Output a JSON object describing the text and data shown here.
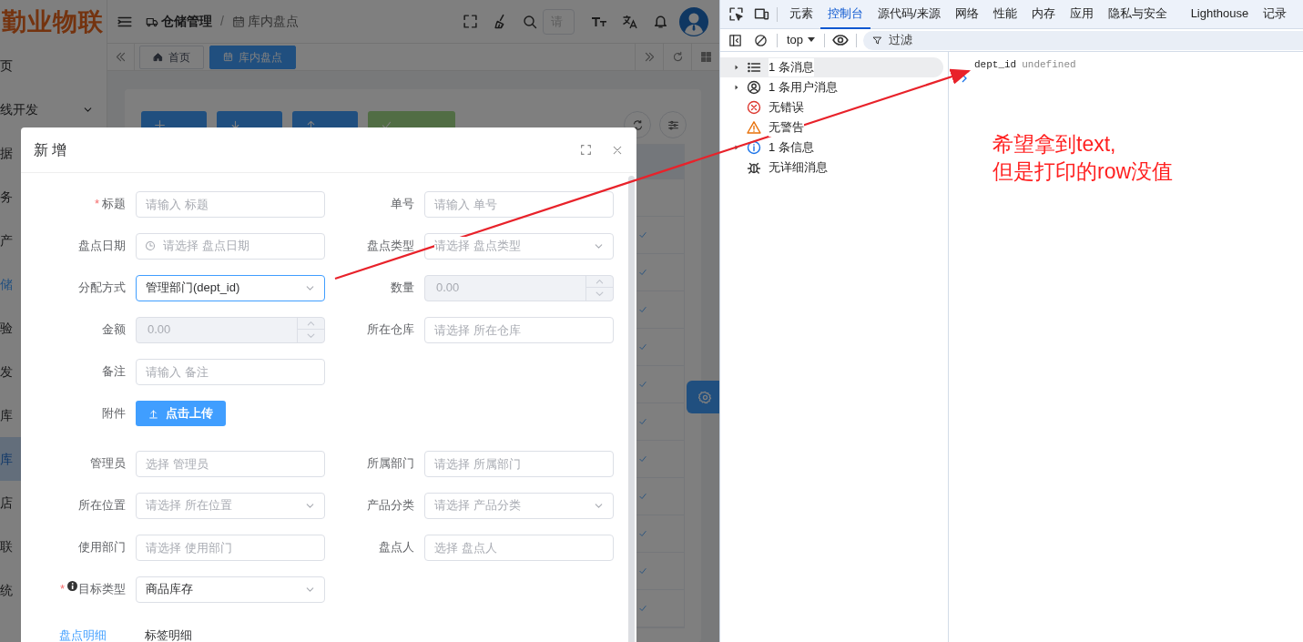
{
  "app": {
    "logo": "勤业物联",
    "sidebar": {
      "items": [
        {
          "label": "页",
          "kind": "plain",
          "selected": false
        },
        {
          "label": "线开发",
          "kind": "group",
          "selected": false
        },
        {
          "label": "据",
          "kind": "plain",
          "selected": false
        },
        {
          "label": "务",
          "kind": "plain",
          "selected": false
        },
        {
          "label": "产",
          "kind": "plain",
          "selected": false
        },
        {
          "label": "储",
          "kind": "active",
          "selected": false
        },
        {
          "label": "验",
          "kind": "plain",
          "selected": false
        },
        {
          "label": "发",
          "kind": "plain",
          "selected": false
        },
        {
          "label": "库",
          "kind": "plain",
          "selected": false
        },
        {
          "label": "库",
          "kind": "active",
          "selected": true
        },
        {
          "label": "店",
          "kind": "plain",
          "selected": false
        },
        {
          "label": "联",
          "kind": "plain",
          "selected": false
        },
        {
          "label": "统",
          "kind": "plain",
          "selected": false
        }
      ]
    },
    "breadcrumb": {
      "separator": "/",
      "items": [
        "仓储管理",
        "库内盘点"
      ]
    },
    "header_search": {
      "placeholder": "请"
    },
    "page_tabs": [
      {
        "label": "首页",
        "selected": false
      },
      {
        "label": "库内盘点",
        "selected": true
      }
    ],
    "toolbar": [
      {
        "kind": "primary",
        "disabled": false
      },
      {
        "kind": "primary",
        "disabled": false
      },
      {
        "kind": "primary",
        "disabled": false
      },
      {
        "kind": "success",
        "disabled": true
      }
    ],
    "required_mark": "*",
    "dialog": {
      "title": "新 增",
      "rows": [
        {
          "fields": [
            {
              "label": "标题",
              "required": true,
              "help": false,
              "kind": "input",
              "placeholder": "请输入 标题",
              "disabled": false,
              "focused": false
            },
            {
              "label": "单号",
              "required": false,
              "help": false,
              "kind": "input",
              "placeholder": "请输入 单号",
              "disabled": false,
              "focused": false
            }
          ]
        },
        {
          "fields": [
            {
              "label": "盘点日期",
              "required": false,
              "help": false,
              "kind": "date",
              "placeholder": "请选择 盘点日期",
              "disabled": false,
              "focused": false
            },
            {
              "label": "盘点类型",
              "required": false,
              "help": false,
              "kind": "select",
              "placeholder": "请选择 盘点类型",
              "disabled": false,
              "focused": false
            }
          ]
        },
        {
          "fields": [
            {
              "label": "分配方式",
              "required": false,
              "help": false,
              "kind": "select",
              "value": "管理部门(dept_id)",
              "disabled": false,
              "focused": true
            },
            {
              "label": "数量",
              "required": false,
              "help": false,
              "kind": "number",
              "value": "0.00",
              "disabled": true,
              "focused": false
            }
          ]
        },
        {
          "fields": [
            {
              "label": "金额",
              "required": false,
              "help": false,
              "kind": "number",
              "value": "0.00",
              "disabled": true,
              "focused": false
            },
            {
              "label": "所在仓库",
              "required": false,
              "help": false,
              "kind": "input",
              "placeholder": "请选择 所在仓库",
              "disabled": false,
              "focused": false
            }
          ]
        },
        {
          "fields": [
            {
              "label": "备注",
              "required": false,
              "help": false,
              "kind": "input",
              "placeholder": "请输入 备注",
              "disabled": false,
              "focused": false
            }
          ]
        },
        {
          "fields": [
            {
              "label": "附件",
              "required": false,
              "help": false,
              "kind": "upload",
              "value": "点击上传",
              "disabled": false,
              "focused": false
            }
          ]
        },
        {
          "fields": [
            {
              "label": "管理员",
              "required": false,
              "help": false,
              "kind": "input",
              "placeholder": "选择 管理员",
              "disabled": false,
              "focused": false
            },
            {
              "label": "所属部门",
              "required": false,
              "help": false,
              "kind": "input",
              "placeholder": "请选择 所属部门",
              "disabled": false,
              "focused": false
            }
          ]
        },
        {
          "fields": [
            {
              "label": "所在位置",
              "required": false,
              "help": false,
              "kind": "select",
              "placeholder": "请选择 所在位置",
              "disabled": false,
              "focused": false
            },
            {
              "label": "产品分类",
              "required": false,
              "help": false,
              "kind": "select",
              "placeholder": "请选择 产品分类",
              "disabled": false,
              "focused": false
            }
          ]
        },
        {
          "fields": [
            {
              "label": "使用部门",
              "required": false,
              "help": false,
              "kind": "input",
              "placeholder": "请选择 使用部门",
              "disabled": false,
              "focused": false
            },
            {
              "label": "盘点人",
              "required": false,
              "help": false,
              "kind": "input",
              "placeholder": "选择 盘点人",
              "disabled": false,
              "focused": false
            }
          ]
        },
        {
          "fields": [
            {
              "label": "目标类型",
              "required": true,
              "help": true,
              "kind": "select",
              "value": "商品库存",
              "disabled": false,
              "focused": false
            }
          ]
        }
      ],
      "tabs": [
        {
          "label": "盘点明细",
          "selected": true
        },
        {
          "label": "标签明细",
          "selected": false
        }
      ]
    }
  },
  "devtools": {
    "tabs": [
      {
        "label": "元素",
        "selected": false
      },
      {
        "label": "控制台",
        "selected": true
      },
      {
        "label": "源代码/来源",
        "selected": false
      },
      {
        "label": "网络",
        "selected": false
      },
      {
        "label": "性能",
        "selected": false
      },
      {
        "label": "内存",
        "selected": false
      },
      {
        "label": "应用",
        "selected": false
      },
      {
        "label": "隐私与安全",
        "selected": false
      },
      {
        "label": "Lighthouse",
        "selected": false
      },
      {
        "label": "记录",
        "selected": false
      }
    ],
    "context": "top",
    "filter": {
      "placeholder": "过滤"
    },
    "sidebar": [
      {
        "label": "1 条消息",
        "kind": "messages",
        "expandable": true,
        "selected": true
      },
      {
        "label": "1 条用户消息",
        "kind": "user",
        "expandable": true,
        "selected": false
      },
      {
        "label": "无错误",
        "kind": "error",
        "expandable": false,
        "selected": false
      },
      {
        "label": "无警告",
        "kind": "warning",
        "expandable": false,
        "selected": false
      },
      {
        "label": "1 条信息",
        "kind": "info",
        "expandable": true,
        "selected": false
      },
      {
        "label": "无详细消息",
        "kind": "verbose",
        "expandable": false,
        "selected": false
      }
    ],
    "console": [
      {
        "key": "dept_id",
        "value": "undefined"
      }
    ]
  },
  "annotation": {
    "lines": [
      "希望拿到text,",
      "但是打印的row没值"
    ]
  }
}
